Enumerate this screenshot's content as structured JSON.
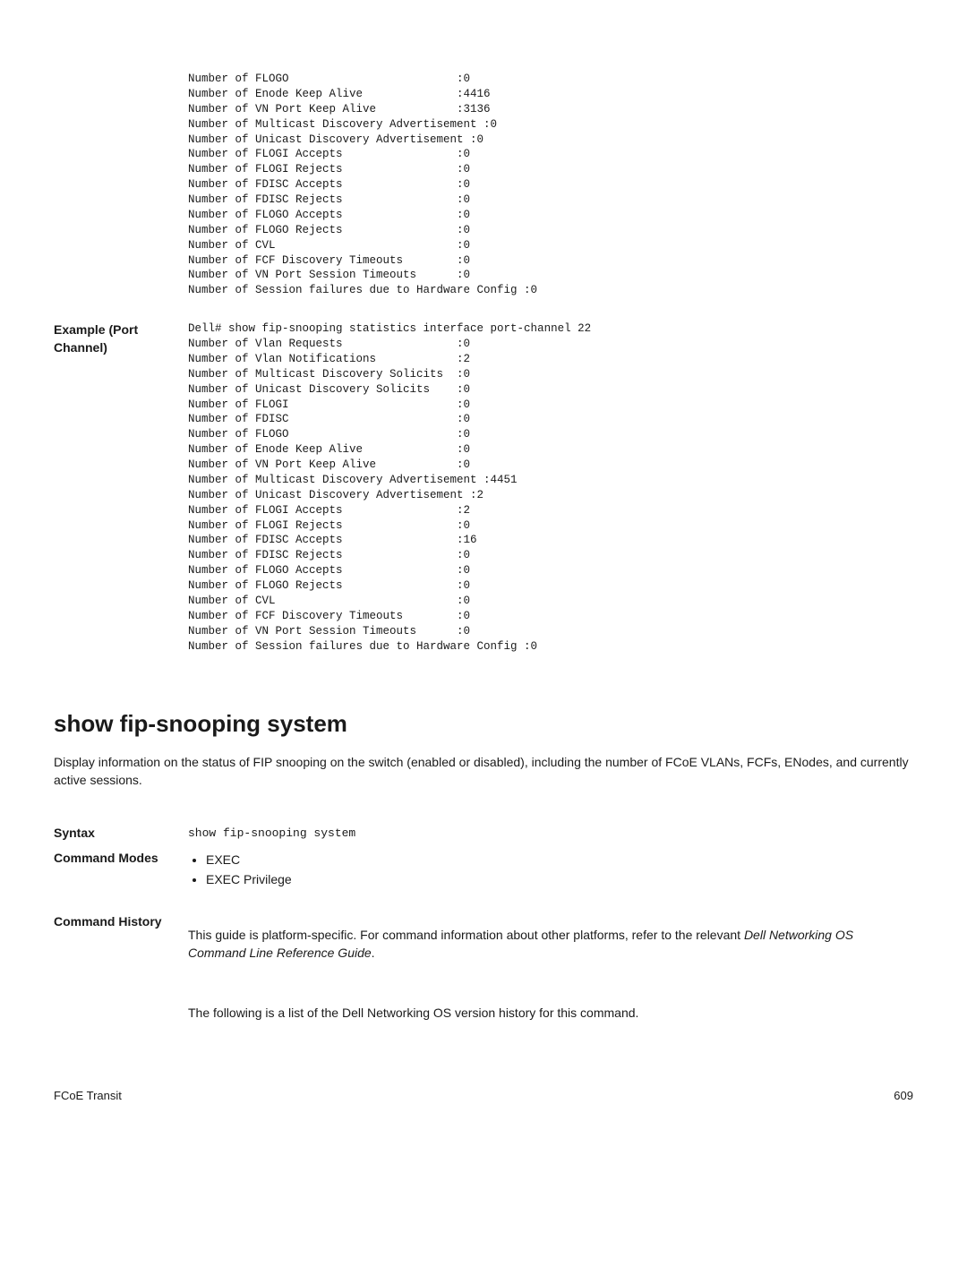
{
  "example1_pre": "Number of FLOGO                         :0\nNumber of Enode Keep Alive              :4416\nNumber of VN Port Keep Alive            :3136\nNumber of Multicast Discovery Advertisement :0\nNumber of Unicast Discovery Advertisement :0\nNumber of FLOGI Accepts                 :0\nNumber of FLOGI Rejects                 :0\nNumber of FDISC Accepts                 :0\nNumber of FDISC Rejects                 :0\nNumber of FLOGO Accepts                 :0\nNumber of FLOGO Rejects                 :0\nNumber of CVL                           :0\nNumber of FCF Discovery Timeouts        :0\nNumber of VN Port Session Timeouts      :0\nNumber of Session failures due to Hardware Config :0",
  "example2_label": "Example (Port Channel)",
  "example2_pre": "Dell# show fip-snooping statistics interface port-channel 22\nNumber of Vlan Requests                 :0\nNumber of Vlan Notifications            :2\nNumber of Multicast Discovery Solicits  :0\nNumber of Unicast Discovery Solicits    :0\nNumber of FLOGI                         :0\nNumber of FDISC                         :0\nNumber of FLOGO                         :0\nNumber of Enode Keep Alive              :0\nNumber of VN Port Keep Alive            :0\nNumber of Multicast Discovery Advertisement :4451\nNumber of Unicast Discovery Advertisement :2\nNumber of FLOGI Accepts                 :2\nNumber of FLOGI Rejects                 :0\nNumber of FDISC Accepts                 :16\nNumber of FDISC Rejects                 :0\nNumber of FLOGO Accepts                 :0\nNumber of FLOGO Rejects                 :0\nNumber of CVL                           :0\nNumber of FCF Discovery Timeouts        :0\nNumber of VN Port Session Timeouts      :0\nNumber of Session failures due to Hardware Config :0",
  "heading": "show fip-snooping system",
  "intro": "Display information on the status of FIP snooping on the switch (enabled or disabled), including the number of FCoE VLANs, FCFs, ENodes, and currently active sessions.",
  "syntax_label": "Syntax",
  "syntax_cmd": "show fip-snooping system",
  "modes_label": "Command Modes",
  "modes_items": [
    "EXEC",
    "EXEC Privilege"
  ],
  "history_label": "Command History",
  "history_p1a": "This guide is platform-specific. For command information about other platforms, refer to the relevant ",
  "history_p1b": "Dell Networking OS Command Line Reference Guide",
  "history_p1c": ".",
  "history_p2": "The following is a list of the Dell Networking OS version history for this command.",
  "footer_left": "FCoE Transit",
  "footer_right": "609"
}
